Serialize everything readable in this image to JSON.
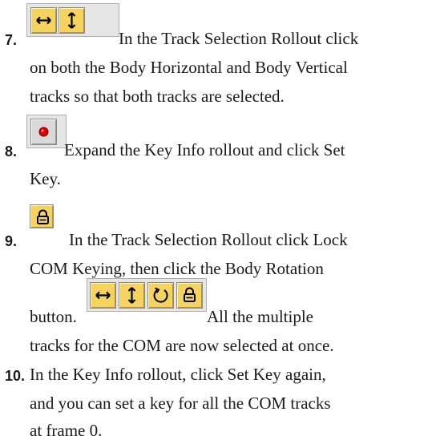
{
  "steps": [
    {
      "number": "7.",
      "lines": [
        "In the Track Selection Rollout click",
        "on both the Body Horizontal and Body Vertical",
        "tracks so that both tracks are selected."
      ],
      "icons": [
        "horizontal-arrows-icon",
        "vertical-arrows-icon"
      ]
    },
    {
      "number": "8.",
      "lines": [
        "Expand the Key Info rollout and click Set",
        "Key."
      ],
      "icons": [
        "set-key-red-dot-icon"
      ]
    },
    {
      "number": "9.",
      "lines": [
        "In the Track Selection Rollout click Lock",
        "COM Keying, then click the Body Rotation",
        "button.",
        "All the multiple",
        "tracks for the COM are now selected at once."
      ],
      "icons": [
        "lock-icon",
        "horizontal-arrows-icon",
        "vertical-arrows-icon",
        "rotation-icon",
        "lock-icon"
      ]
    },
    {
      "number": "10.",
      "lines": [
        "In the Key Info rollout, click Set Key again,",
        "and you can set a key for all the COM tracks",
        "at frame 0."
      ]
    }
  ],
  "colors": {
    "button_yellow": "#f4d35f",
    "button_gray": "#d9d9d9",
    "key_red": "#e00000",
    "text": "#1a1a1a"
  }
}
